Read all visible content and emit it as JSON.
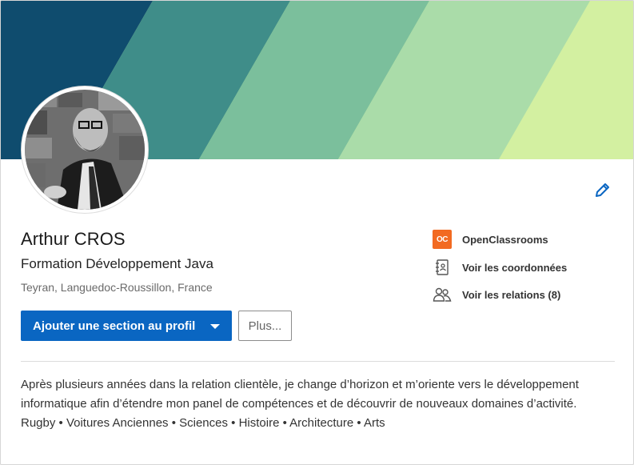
{
  "profile": {
    "name": "Arthur CROS",
    "headline": "Formation Développement Java",
    "location": "Teyran, Languedoc-Roussillon, France"
  },
  "actions": {
    "add_section_label": "Ajouter une section au profil",
    "more_label": "Plus..."
  },
  "sidebar": {
    "items": [
      {
        "label": "OpenClassrooms",
        "icon": "openclassrooms-logo",
        "logo_text": "OC"
      },
      {
        "label": "Voir les coordonnées",
        "icon": "contact-book-icon"
      },
      {
        "label": "Voir les relations (8)",
        "icon": "connections-icon"
      }
    ]
  },
  "about": {
    "lines": [
      "Après plusieurs années dans la relation clientèle, je change d’horizon et m’oriente vers le développement",
      "informatique afin d’étendre mon panel de compétences et de découvrir de nouveaux domaines d’activité.",
      "Rugby • Voitures Anciennes • Sciences • Histoire • Architecture • Arts"
    ]
  },
  "colors": {
    "primary": "#0a66c2",
    "banner": [
      "#0f4c6e",
      "#3f8d89",
      "#7bbf9c",
      "#aadca9",
      "#d3f0a1"
    ],
    "oc_brand": "#f26a21"
  }
}
